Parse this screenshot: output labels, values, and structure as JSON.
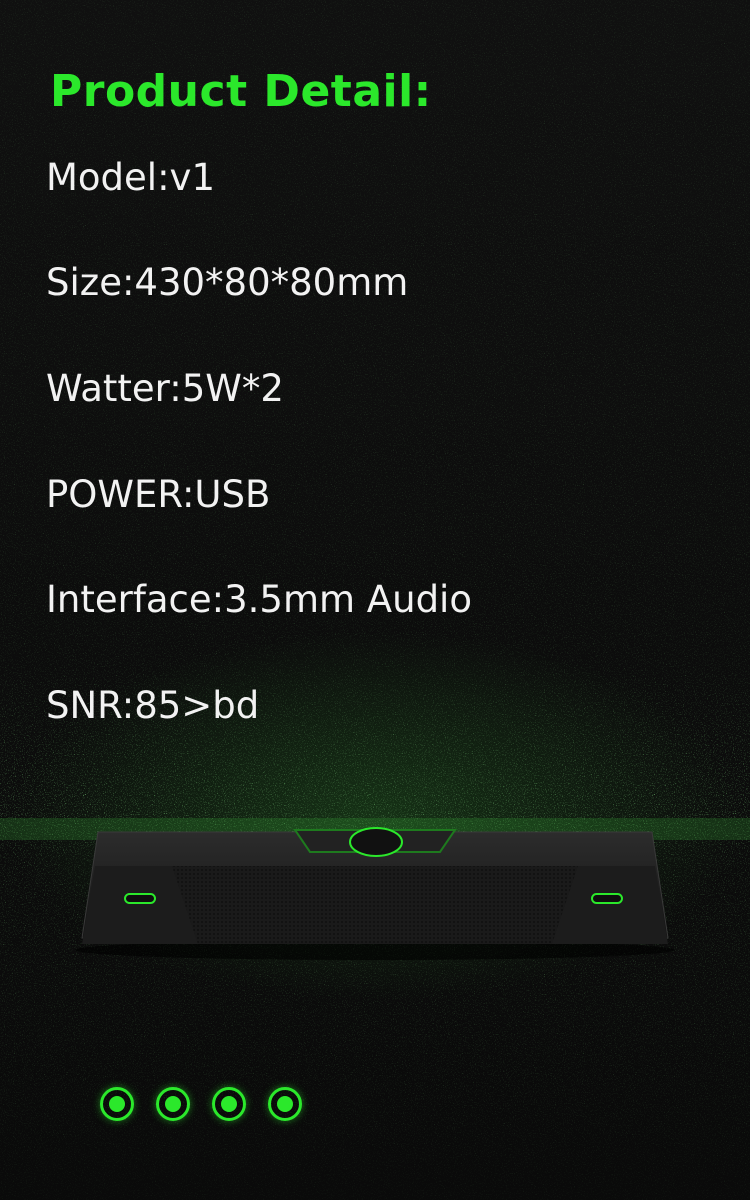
{
  "heading": "Product Detail:",
  "specs": [
    "Model:v1",
    "Size:430*80*80mm",
    "Watter:5W*2",
    "POWER:USB",
    "Interface:3.5mm Audio",
    "SNR:85>bd"
  ],
  "colors": {
    "accent": "#2be82b",
    "text": "#f2f2f2",
    "background": "#0b0b0b"
  },
  "carousel": {
    "count": 4
  }
}
